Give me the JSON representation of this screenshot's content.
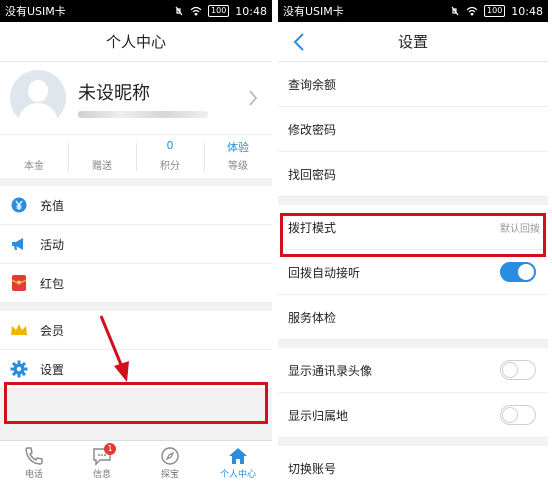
{
  "status_bar": {
    "carrier": "没有USIM卡",
    "battery": "100",
    "time": "10:48"
  },
  "left": {
    "title": "个人中心",
    "profile": {
      "nickname": "未设昵称"
    },
    "stats": [
      {
        "value": "",
        "label": "本金"
      },
      {
        "value": "",
        "label": "赠送"
      },
      {
        "value": "0",
        "label": "积分"
      },
      {
        "value": "体验",
        "label": "等级"
      }
    ],
    "menu_group1": [
      {
        "icon": "yen-icon",
        "label": "充值"
      },
      {
        "icon": "megaphone-icon",
        "label": "活动"
      },
      {
        "icon": "red-envelope-icon",
        "label": "红包"
      }
    ],
    "menu_group2": [
      {
        "icon": "crown-icon",
        "label": "会员"
      },
      {
        "icon": "gear-icon",
        "label": "设置"
      }
    ],
    "tabs": [
      {
        "icon": "phone-icon",
        "label": "电话"
      },
      {
        "icon": "chat-icon",
        "label": "信息",
        "badge": "1"
      },
      {
        "icon": "compass-icon",
        "label": "探宝"
      },
      {
        "icon": "home-icon",
        "label": "个人中心"
      }
    ]
  },
  "right": {
    "title": "设置",
    "group1": [
      {
        "label": "查询余额"
      },
      {
        "label": "修改密码"
      },
      {
        "label": "找回密码"
      }
    ],
    "group2": [
      {
        "label": "拨打模式",
        "value": "默认回拨"
      },
      {
        "label": "回拨自动接听",
        "toggle": "on"
      },
      {
        "label": "服务体检"
      }
    ],
    "group3": [
      {
        "label": "显示通讯录头像",
        "toggle": "off"
      },
      {
        "label": "显示归属地",
        "toggle": "off"
      }
    ],
    "group4": [
      {
        "label": "切换账号"
      }
    ]
  },
  "colors": {
    "accent": "#2a8de0",
    "highlight": "#d0111b",
    "badge": "#e53935"
  }
}
